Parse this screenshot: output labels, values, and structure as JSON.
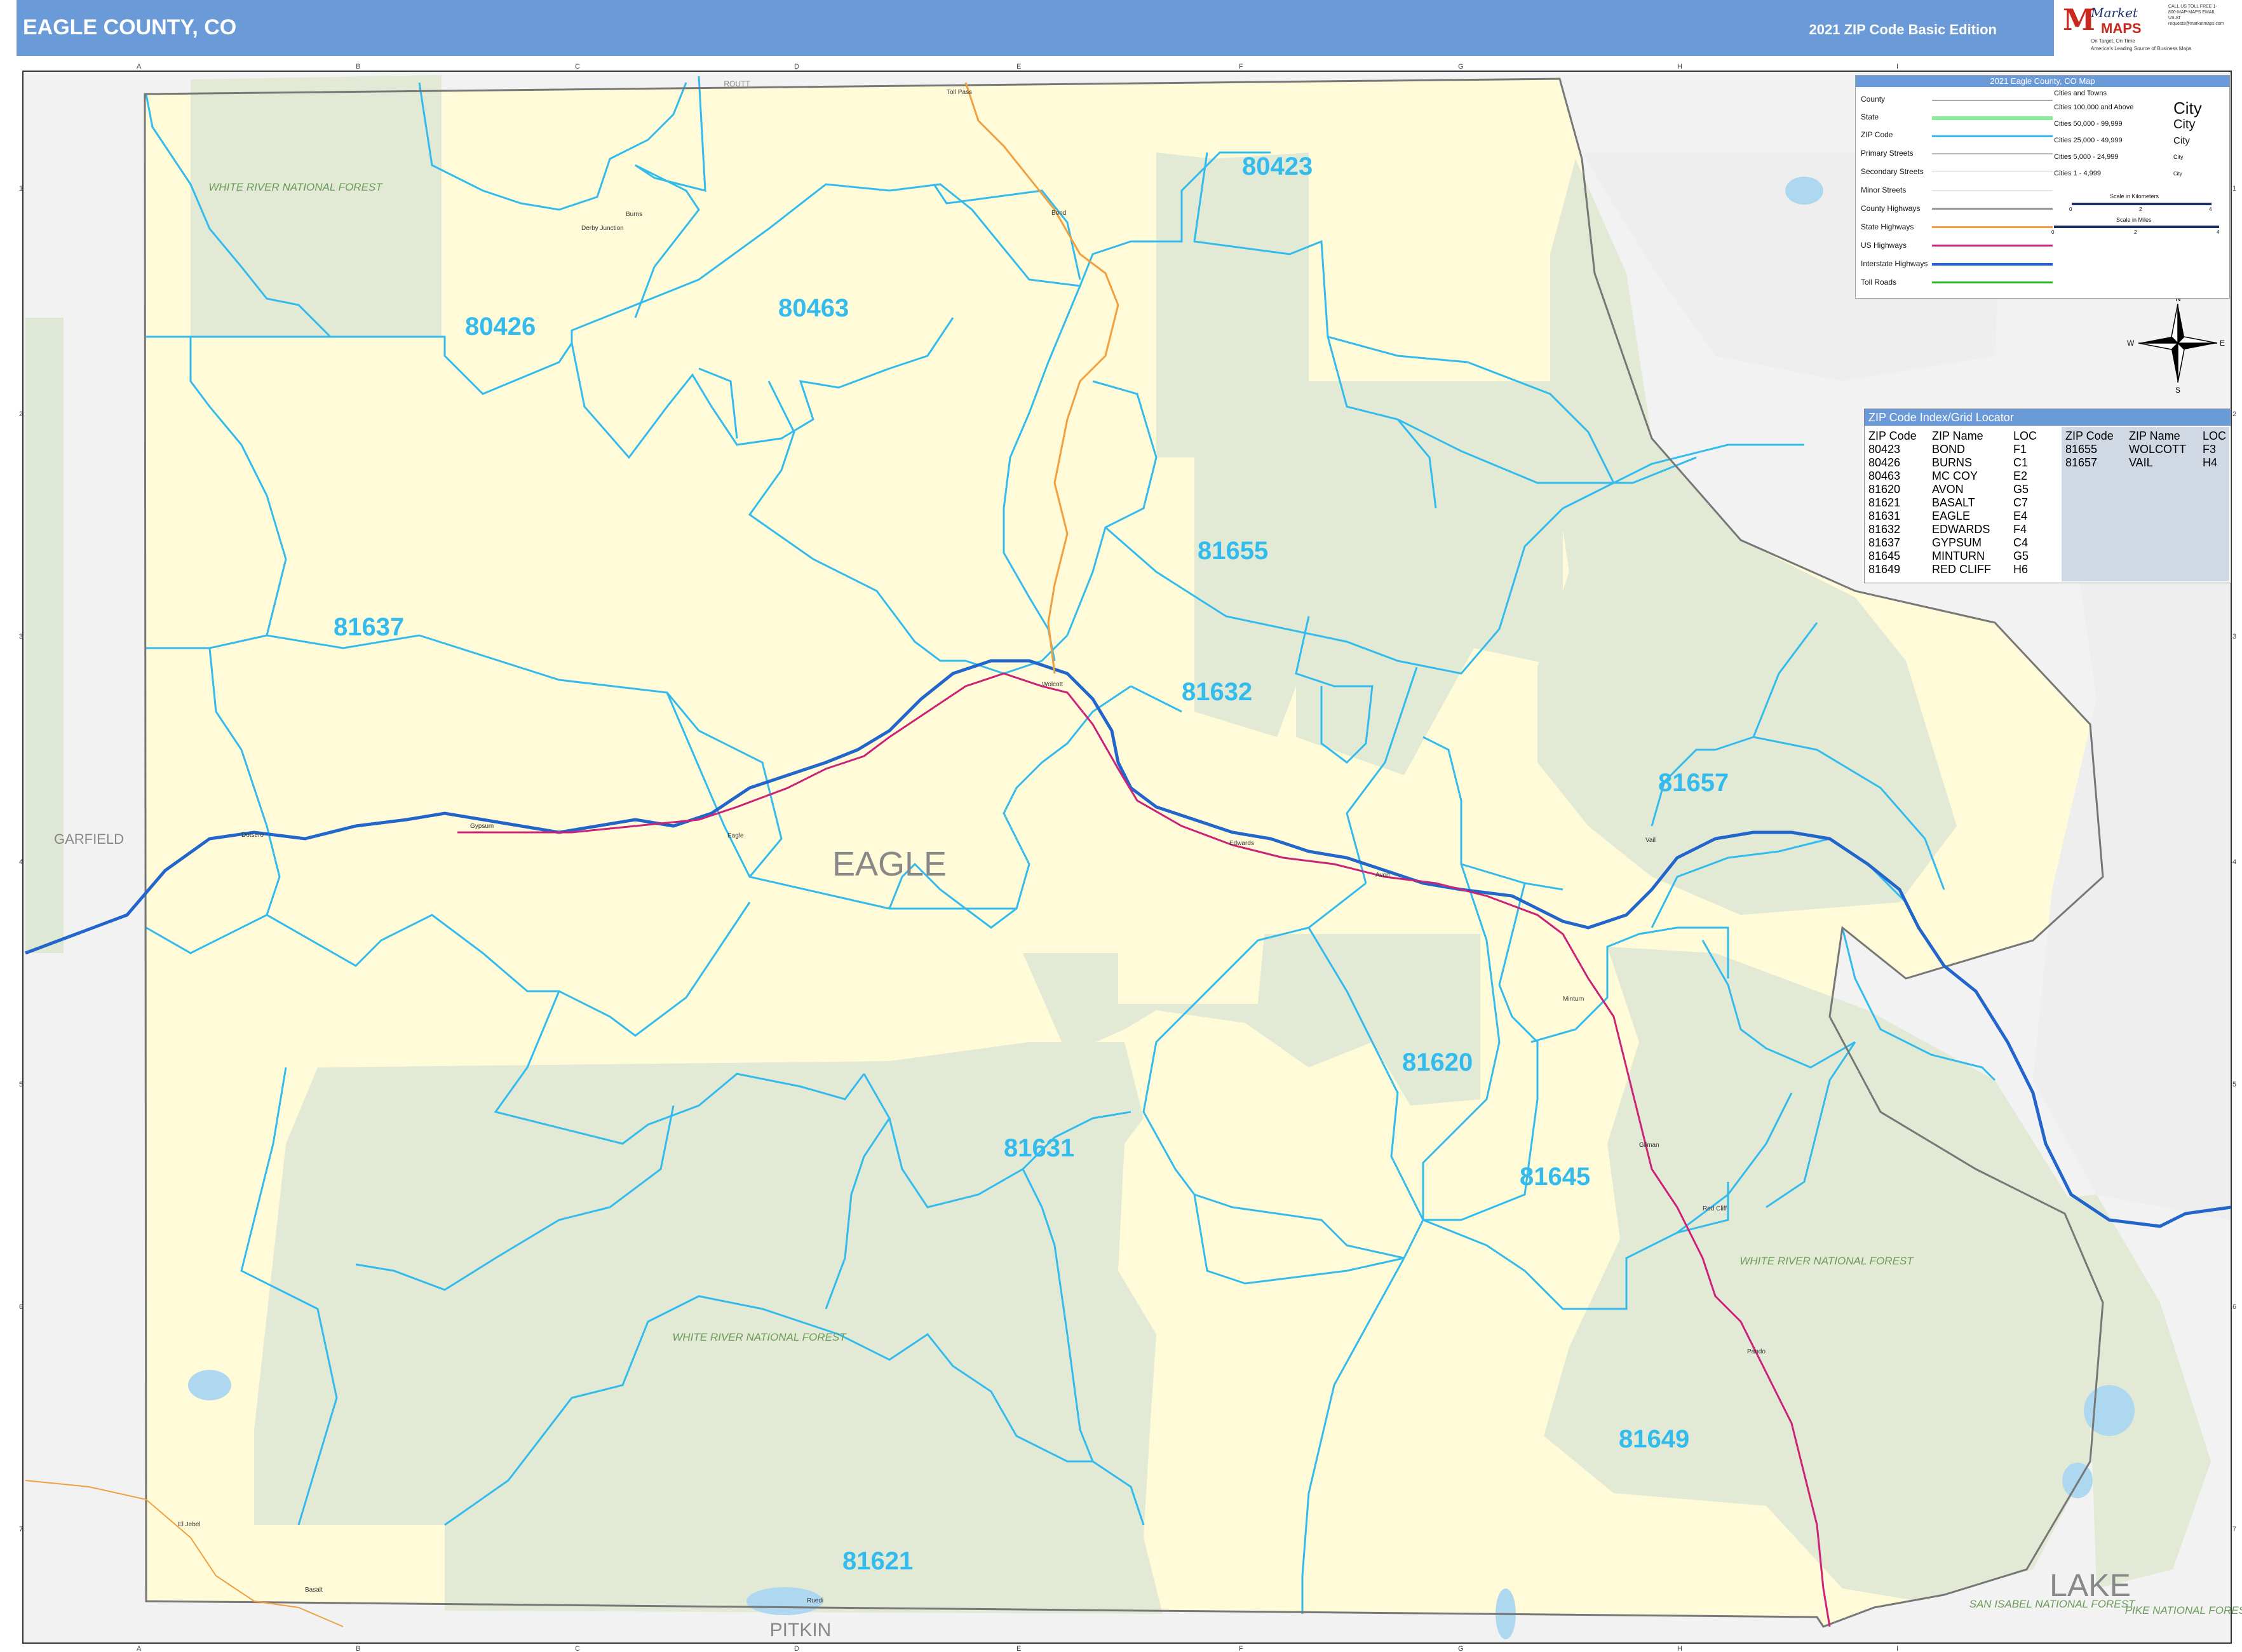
{
  "header": {
    "title": "EAGLE COUNTY, CO",
    "edition": "2021 ZIP Code Basic Edition",
    "logo": {
      "brand_line1": "Market",
      "brand_line2": "MAPS",
      "slogan": "On Target, On Time",
      "tagline": "America's Leading Source of Business Maps",
      "contact": "CALL US TOLL FREE 1-800-MAP-MAPS EMAIL US AT requests@marketmaps.com"
    }
  },
  "map": {
    "county_name": "EAGLE",
    "neighbor_counties": [
      "GARFIELD",
      "ROUTT",
      "PITKIN",
      "LAKE"
    ],
    "forest_labels": [
      "WHITE RIVER NATIONAL FOREST",
      "SAN ISABEL NATIONAL FOREST",
      "PIKE NATIONAL FOREST"
    ],
    "grid_columns": [
      "A",
      "B",
      "C",
      "D",
      "E",
      "F",
      "G",
      "H",
      "I"
    ],
    "grid_rows": [
      "1",
      "2",
      "3",
      "4",
      "5",
      "6",
      "7"
    ],
    "zip_labels": [
      "80423",
      "80426",
      "80463",
      "81655",
      "81637",
      "81632",
      "81657",
      "81620",
      "81631",
      "81645",
      "81649",
      "81621"
    ],
    "town_labels": [
      "Bond",
      "Burns",
      "Derby Junction",
      "Gypsum",
      "Eagle",
      "Edwards",
      "Avon",
      "Minturn",
      "Gilman",
      "Red Cliff",
      "Pando",
      "El Jebel",
      "Basalt",
      "Ruedi",
      "Dotsero",
      "Wolcott",
      "Vail",
      "Toll Pass"
    ],
    "compass": {
      "n": "N",
      "s": "S",
      "e": "E",
      "w": "W"
    }
  },
  "legend": {
    "title": "2021 Eagle County, CO Map",
    "items": [
      "County",
      "State",
      "ZIP Code",
      "Primary Streets",
      "Secondary Streets",
      "Minor Streets",
      "County Highways",
      "State Highways",
      "US Highways",
      "Interstate Highways",
      "Toll Roads"
    ],
    "cities_header": "Cities and Towns",
    "city_sizes": [
      "Cities 100,000 and Above",
      "Cities 50,000 - 99,999",
      "Cities 25,000 - 49,999",
      "Cities 5,000 - 24,999",
      "Cities 1 - 4,999"
    ],
    "city_samples": [
      "City",
      "City",
      "City",
      "City",
      "City"
    ],
    "scale_km": "Scale in Kilometers",
    "scale_mi": "Scale in Miles",
    "scale_ticks_km": [
      "0",
      "2",
      "4"
    ],
    "scale_ticks_mi": [
      "0",
      "2",
      "4"
    ],
    "colors": {
      "county": "#999999",
      "state": "#88ee99",
      "zip": "#33bbee",
      "interstate": "#2266cc",
      "us": "#cc2277",
      "state_hwy": "#f0a040",
      "toll": "#22bb22"
    }
  },
  "zip_index": {
    "title": "ZIP Code Index/Grid Locator",
    "headers": [
      "ZIP Code",
      "ZIP Name",
      "LOC"
    ],
    "rows": [
      [
        "80423",
        "BOND",
        "F1"
      ],
      [
        "80426",
        "BURNS",
        "C1"
      ],
      [
        "80463",
        "MC COY",
        "E2"
      ],
      [
        "81620",
        "AVON",
        "G5"
      ],
      [
        "81621",
        "BASALT",
        "C7"
      ],
      [
        "81631",
        "EAGLE",
        "E4"
      ],
      [
        "81632",
        "EDWARDS",
        "F4"
      ],
      [
        "81637",
        "GYPSUM",
        "C4"
      ],
      [
        "81645",
        "MINTURN",
        "G5"
      ],
      [
        "81649",
        "RED CLIFF",
        "H6"
      ],
      [
        "81655",
        "WOLCOTT",
        "F3"
      ],
      [
        "81657",
        "VAIL",
        "H4"
      ]
    ]
  }
}
